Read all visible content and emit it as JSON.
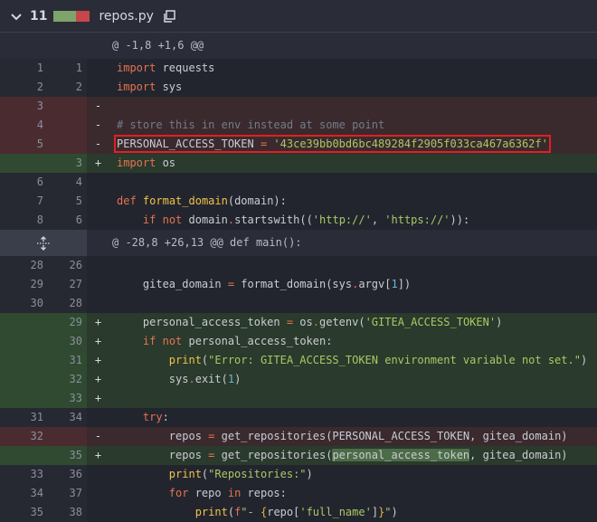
{
  "header": {
    "changes_count": "11",
    "filename": "repos.py",
    "colors": {
      "add": "#7ea36b",
      "del": "#c6474b"
    }
  },
  "hunks": [
    "@ -1,8 +1,6 @@",
    "@ -28,8 +26,13 @@ def main():"
  ],
  "lines": [
    {
      "old": "1",
      "new": "1",
      "sign": "",
      "type": "ctx",
      "code": "import requests"
    },
    {
      "old": "2",
      "new": "2",
      "sign": "",
      "type": "ctx",
      "code": "import sys"
    },
    {
      "old": "3",
      "new": "",
      "sign": "-",
      "type": "del",
      "code": ""
    },
    {
      "old": "4",
      "new": "",
      "sign": "-",
      "type": "del",
      "code": "# store this in env instead at some point"
    },
    {
      "old": "5",
      "new": "",
      "sign": "-",
      "type": "del",
      "code": "PERSONAL_ACCESS_TOKEN = '43ce39bb0bd6bc489284f2905f033ca467a6362f'"
    },
    {
      "old": "",
      "new": "3",
      "sign": "+",
      "type": "add",
      "code": "import os"
    },
    {
      "old": "6",
      "new": "4",
      "sign": "",
      "type": "ctx",
      "code": ""
    },
    {
      "old": "7",
      "new": "5",
      "sign": "",
      "type": "ctx",
      "code": "def format_domain(domain):"
    },
    {
      "old": "8",
      "new": "6",
      "sign": "",
      "type": "ctx",
      "code": "    if not domain.startswith(('http://', 'https://')):"
    },
    {
      "old": "28",
      "new": "26",
      "sign": "",
      "type": "ctx",
      "code": ""
    },
    {
      "old": "29",
      "new": "27",
      "sign": "",
      "type": "ctx",
      "code": "    gitea_domain = format_domain(sys.argv[1])"
    },
    {
      "old": "30",
      "new": "28",
      "sign": "",
      "type": "ctx",
      "code": ""
    },
    {
      "old": "",
      "new": "29",
      "sign": "+",
      "type": "add",
      "code": "    personal_access_token = os.getenv('GITEA_ACCESS_TOKEN')"
    },
    {
      "old": "",
      "new": "30",
      "sign": "+",
      "type": "add",
      "code": "    if not personal_access_token:"
    },
    {
      "old": "",
      "new": "31",
      "sign": "+",
      "type": "add",
      "code": "        print(\"Error: GITEA_ACCESS_TOKEN environment variable not set.\")"
    },
    {
      "old": "",
      "new": "32",
      "sign": "+",
      "type": "add",
      "code": "        sys.exit(1)"
    },
    {
      "old": "",
      "new": "33",
      "sign": "+",
      "type": "add",
      "code": ""
    },
    {
      "old": "31",
      "new": "34",
      "sign": "",
      "type": "ctx",
      "code": "    try:"
    },
    {
      "old": "32",
      "new": "",
      "sign": "-",
      "type": "del",
      "code": "        repos = get_repositories(PERSONAL_ACCESS_TOKEN, gitea_domain)"
    },
    {
      "old": "",
      "new": "35",
      "sign": "+",
      "type": "add",
      "code": "        repos = get_repositories(personal_access_token, gitea_domain)"
    },
    {
      "old": "33",
      "new": "36",
      "sign": "",
      "type": "ctx",
      "code": "        print(\"Repositories:\")"
    },
    {
      "old": "34",
      "new": "37",
      "sign": "",
      "type": "ctx",
      "code": "        for repo in repos:"
    },
    {
      "old": "35",
      "new": "38",
      "sign": "",
      "type": "ctx",
      "code": "            print(f\"- {repo['full_name']}\")"
    }
  ]
}
